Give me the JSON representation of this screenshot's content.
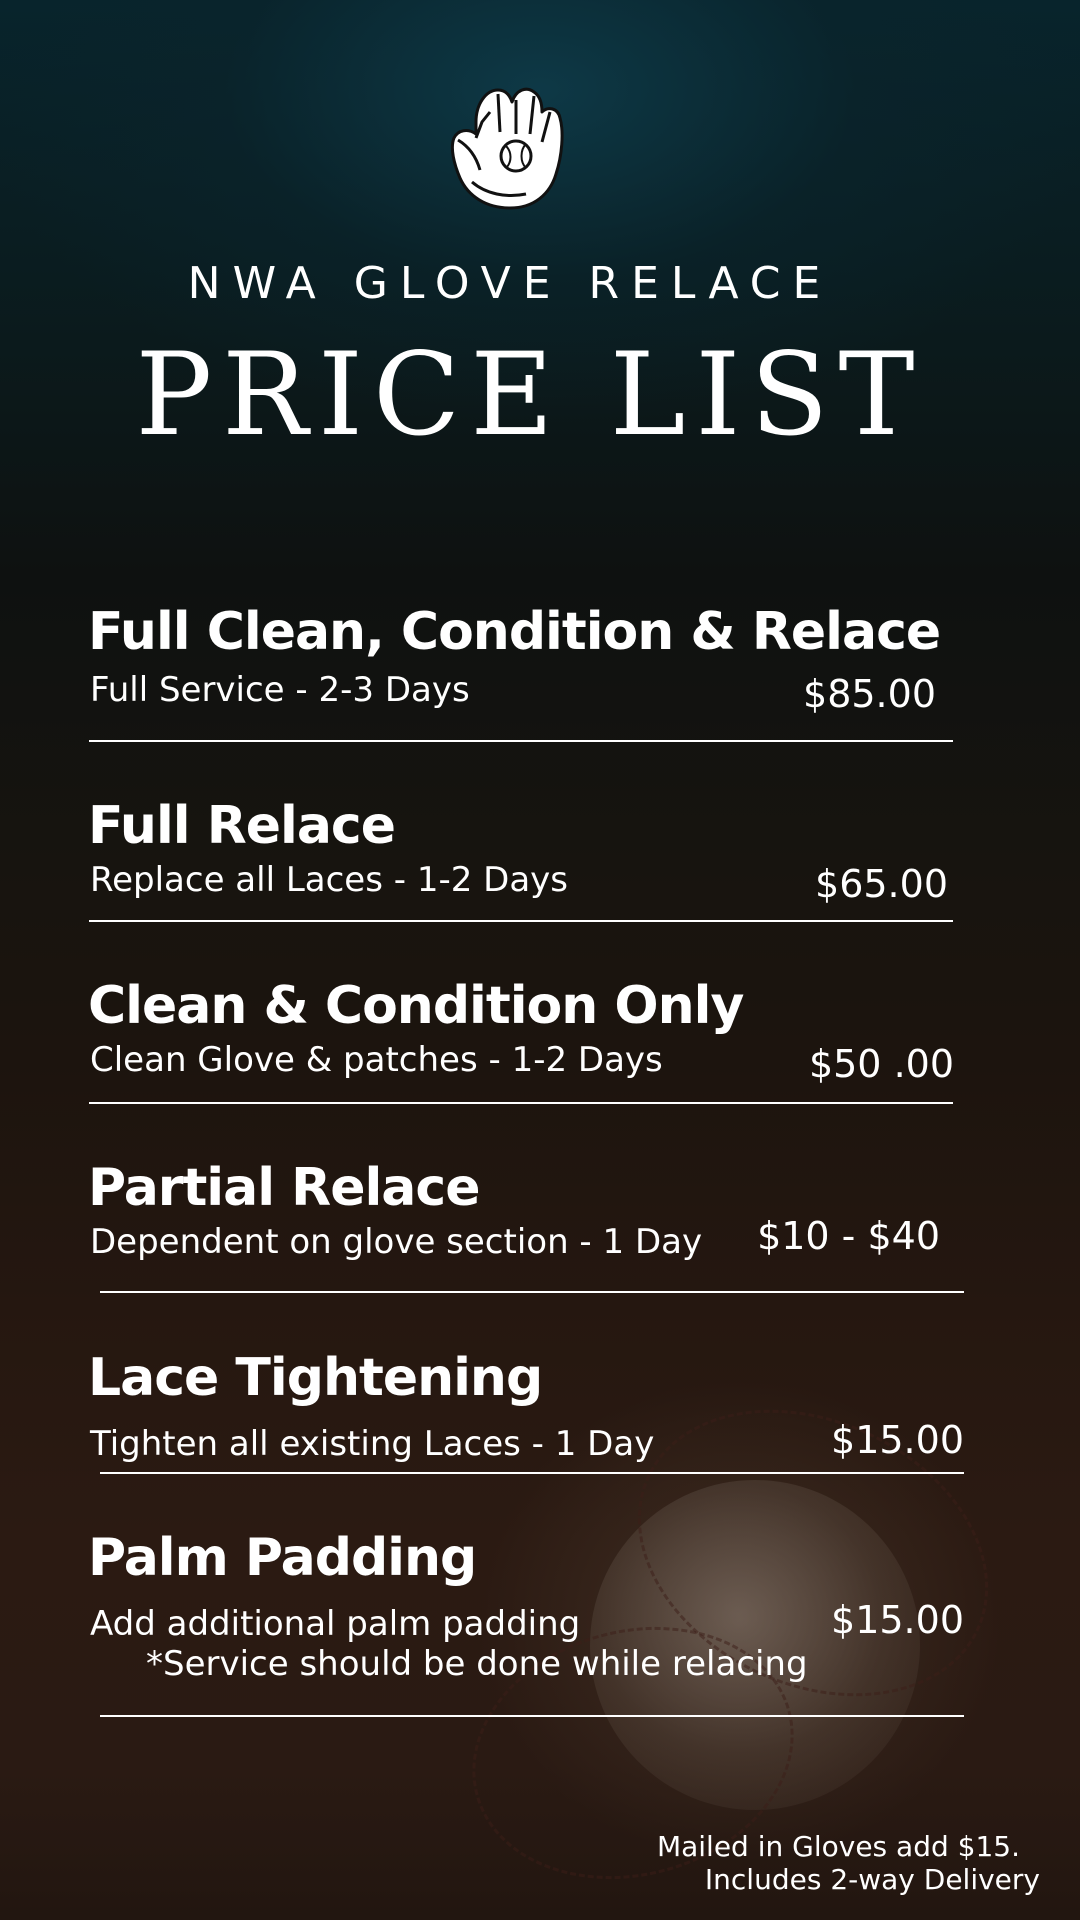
{
  "header": {
    "logo_icon": "baseball-glove-icon",
    "brand": "NWA GLOVE RELACE",
    "title": "PRICE LIST"
  },
  "items": [
    {
      "name": "Full Clean, Condition & Relace",
      "desc": "Full Service - 2-3 Days",
      "note": "",
      "price": "$85.00"
    },
    {
      "name": "Full Relace",
      "desc": "Replace all Laces - 1-2 Days",
      "note": "",
      "price": "$65.00"
    },
    {
      "name": "Clean & Condition Only",
      "desc": "Clean Glove & patches - 1-2 Days",
      "note": "",
      "price": "$50 .00"
    },
    {
      "name": "Partial Relace",
      "desc": "Dependent on glove section - 1 Day",
      "note": "",
      "price": "$10 - $40"
    },
    {
      "name": "Lace Tightening",
      "desc": "Tighten all existing Laces - 1 Day",
      "note": "",
      "price": "$15.00"
    },
    {
      "name": "Palm Padding",
      "desc": "Add additional palm padding",
      "note": "*Service should be done while relacing",
      "price": "$15.00"
    }
  ],
  "footer": {
    "line1": "Mailed in Gloves add $15.",
    "line2": "Includes 2-way Delivery"
  },
  "colors": {
    "text": "#ffffff",
    "top_tint": "#0a2a34",
    "bottom_tint": "#2a1a13"
  }
}
